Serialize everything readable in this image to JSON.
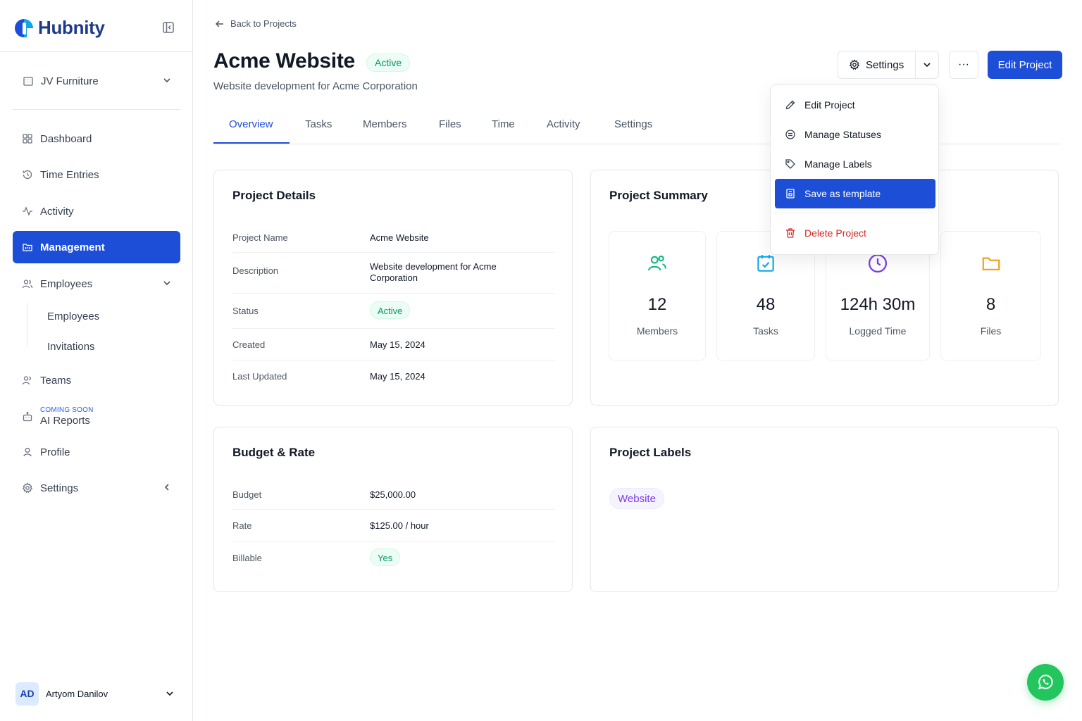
{
  "brand": {
    "name": "Hubnity"
  },
  "sidebar": {
    "org": "JV Furniture",
    "items": [
      {
        "label": "Dashboard"
      },
      {
        "label": "Time Entries"
      },
      {
        "label": "Activity"
      },
      {
        "label": "Management"
      },
      {
        "label": "Employees"
      },
      {
        "label": "Teams"
      },
      {
        "label": "AI Reports",
        "tag": "COMING SOON"
      },
      {
        "label": "Profile"
      },
      {
        "label": "Settings"
      }
    ],
    "sub_items": [
      {
        "label": "Employees"
      },
      {
        "label": "Invitations"
      }
    ],
    "active_item": "Management",
    "user": {
      "initials": "AD",
      "name": "Artyom Danilov"
    }
  },
  "header": {
    "back_label": "Back to Projects",
    "title": "Acme Website",
    "status": "Active",
    "subtitle": "Website development for Acme Corporation",
    "settings_label": "Settings",
    "more_label": "···",
    "edit_label": "Edit Project"
  },
  "tabs": [
    {
      "label": "Overview",
      "active": true
    },
    {
      "label": "Tasks"
    },
    {
      "label": "Members"
    },
    {
      "label": "Files"
    },
    {
      "label": "Time"
    },
    {
      "label": "Activity"
    },
    {
      "label": "Settings"
    }
  ],
  "dropdown": {
    "items": [
      {
        "label": "Edit Project",
        "icon": "pencil-icon"
      },
      {
        "label": "Manage Statuses",
        "icon": "statuses-icon"
      },
      {
        "label": "Manage Labels",
        "icon": "tag-icon"
      },
      {
        "label": "Save as template",
        "icon": "template-icon",
        "highlighted": true
      },
      {
        "label": "Delete Project",
        "icon": "trash-icon",
        "danger": true
      }
    ]
  },
  "project_details": {
    "title": "Project Details",
    "rows": [
      {
        "label": "Project Name",
        "value": "Acme Website"
      },
      {
        "label": "Description",
        "value": "Website development for Acme Corporation"
      },
      {
        "label": "Status",
        "value": "Active"
      },
      {
        "label": "Created",
        "value": "May 15, 2024"
      },
      {
        "label": "Last Updated",
        "value": "May 15, 2024"
      }
    ]
  },
  "project_summary": {
    "title": "Project Summary",
    "stats": [
      {
        "value": "12",
        "label": "Members",
        "icon": "users-icon",
        "color": "#10b981"
      },
      {
        "value": "48",
        "label": "Tasks",
        "icon": "calendar-check-icon",
        "color": "#0ea5e9"
      },
      {
        "value": "124h 30m",
        "label": "Logged Time",
        "icon": "clock-icon",
        "color": "#7c3aed"
      },
      {
        "value": "8",
        "label": "Files",
        "icon": "folder-icon",
        "color": "#f59e0b"
      }
    ]
  },
  "budget": {
    "title": "Budget & Rate",
    "rows": [
      {
        "label": "Budget",
        "value": "$25,000.00"
      },
      {
        "label": "Rate",
        "value": "$125.00 / hour"
      },
      {
        "label": "Billable",
        "value": "Yes"
      }
    ]
  },
  "labels": {
    "title": "Project Labels",
    "items": [
      "Website"
    ]
  },
  "colors": {
    "accent": "#1d4ed8",
    "success": "#059669",
    "danger": "#dc2626",
    "label": "#7c3aed",
    "whatsapp": "#22c55e"
  }
}
